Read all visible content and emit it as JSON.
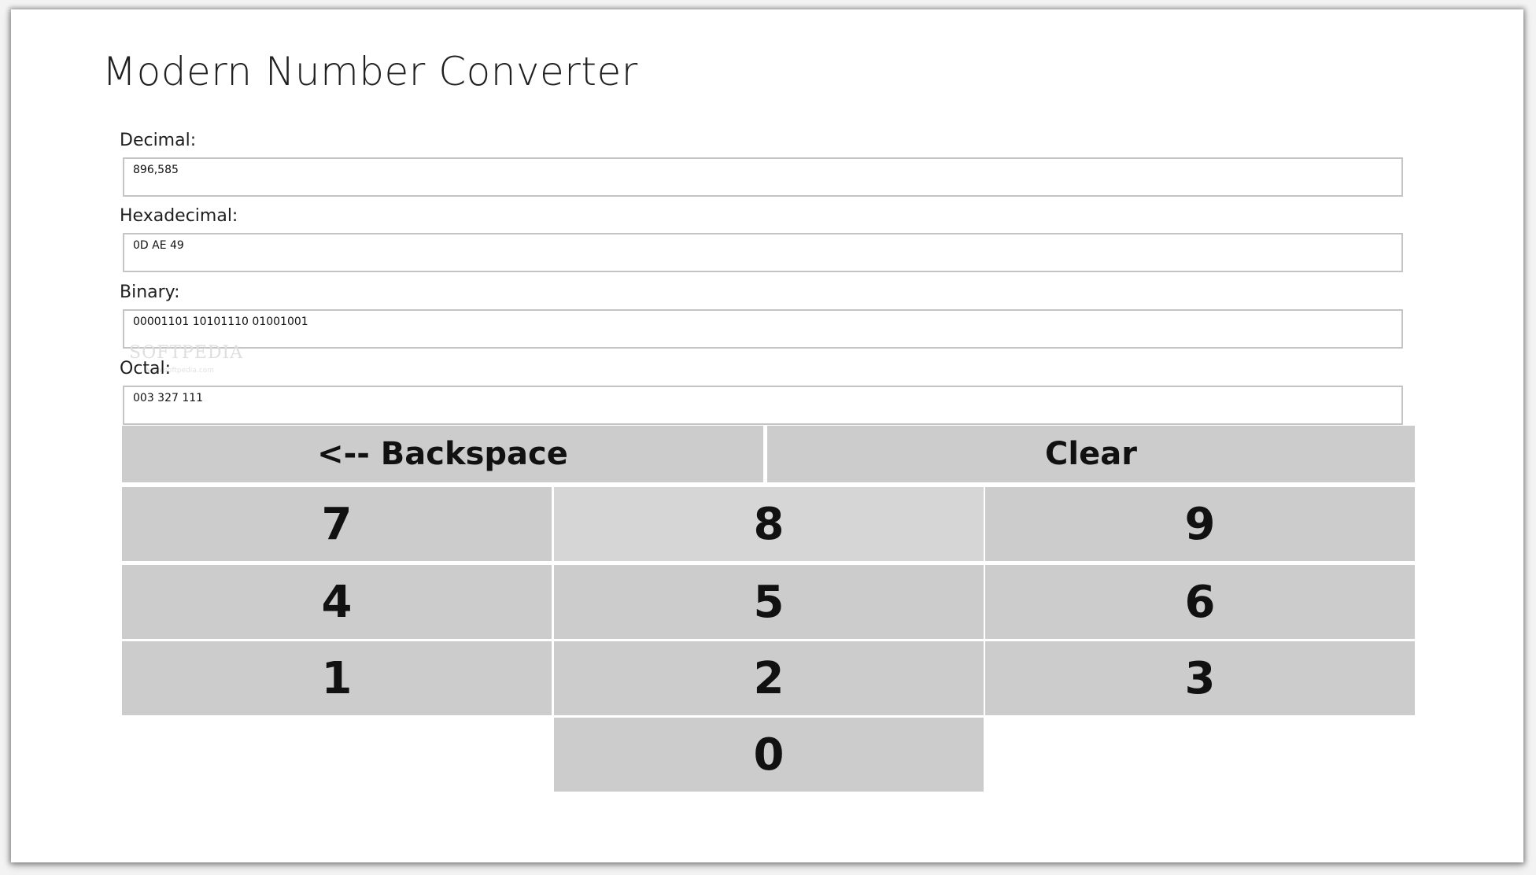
{
  "app": {
    "title": "Modern Number Converter"
  },
  "fields": {
    "decimal": {
      "label": "Decimal:",
      "value": "896,585"
    },
    "hexadecimal": {
      "label": "Hexadecimal:",
      "value": "0D AE 49"
    },
    "binary": {
      "label": "Binary:",
      "value": "00001101 10101110 01001001"
    },
    "octal": {
      "label": "Octal:",
      "value": "003 327 111"
    }
  },
  "watermark": {
    "text": "SOFTPEDIA",
    "sub": "www.softpedia.com"
  },
  "keypad": {
    "backspace_label": "<-- Backspace",
    "clear_label": "Clear",
    "digits": {
      "d7": "7",
      "d8": "8",
      "d9": "9",
      "d4": "4",
      "d5": "5",
      "d6": "6",
      "d1": "1",
      "d2": "2",
      "d3": "3",
      "d0": "0"
    }
  },
  "colors": {
    "key_background": "#cccccc",
    "key_hover_background": "#d6d6d6",
    "field_border": "#c4c4c4",
    "window_background": "#ffffff"
  }
}
